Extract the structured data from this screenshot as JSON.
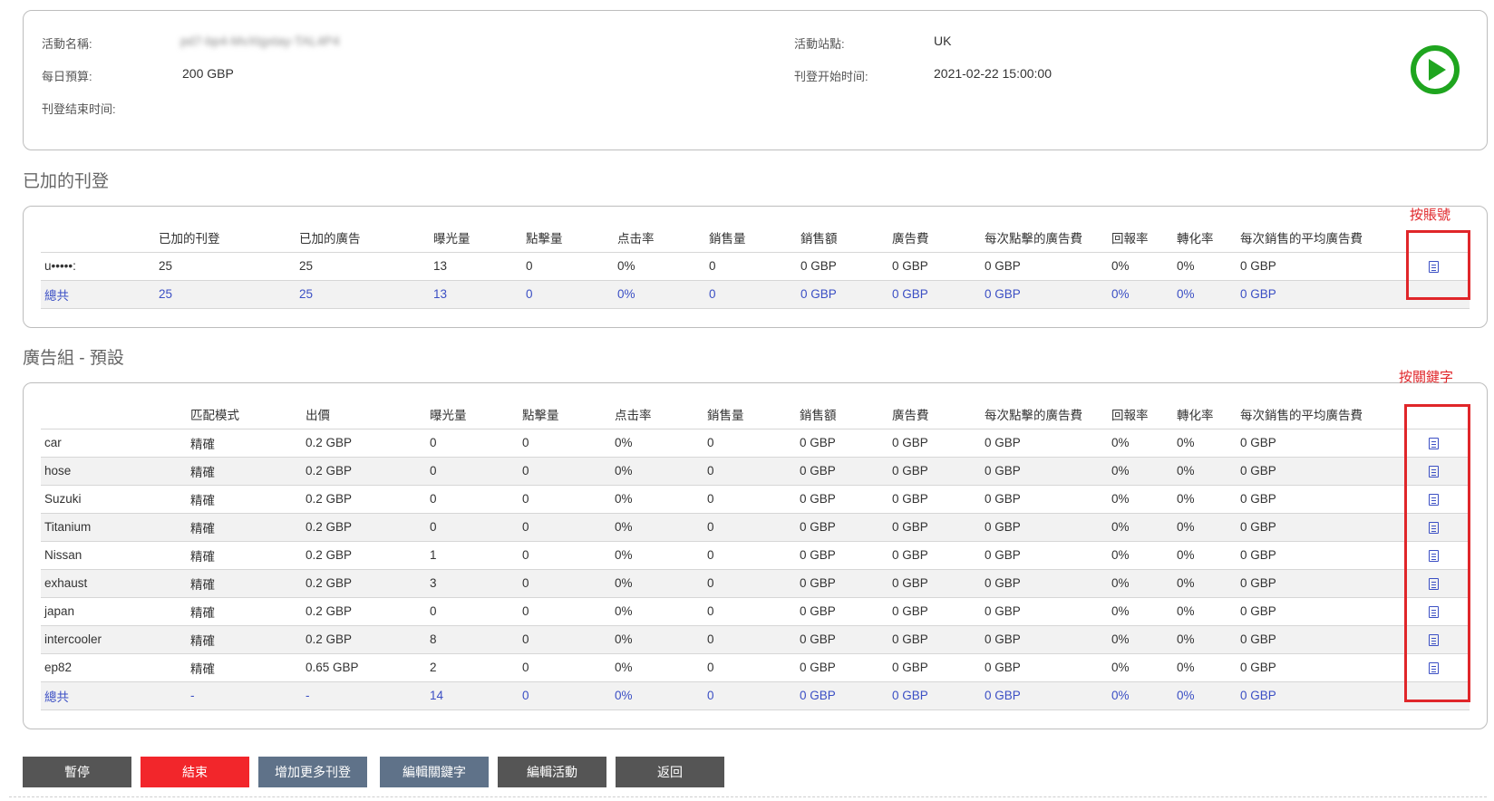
{
  "info": {
    "name_label": "活動名稱:",
    "name_value": "pd7-bp4-MvXtgxtay-TAL4P4",
    "budget_label": "每日預算:",
    "budget_value": "200 GBP",
    "end_label": "刊登结束时间:",
    "end_value": "",
    "site_label": "活動站點:",
    "site_value": "UK",
    "start_label": "刊登开始时间:",
    "start_value": "2021-02-22 15:00:00"
  },
  "listings": {
    "title": "已加的刊登",
    "headers": [
      "",
      "已加的刊登",
      "已加的廣告",
      "曝光量",
      "點擊量",
      "点击率",
      "銷售量",
      "銷售額",
      "廣告費",
      "每次點擊的廣告費",
      "回報率",
      "轉化率",
      "每次銷售的平均廣告費",
      ""
    ],
    "rows": [
      [
        "u•••••:",
        "25",
        "25",
        "13",
        "0",
        "0%",
        "0",
        "0 GBP",
        "0 GBP",
        "0 GBP",
        "0%",
        "0%",
        "0 GBP"
      ]
    ],
    "total": [
      "總共",
      "25",
      "25",
      "13",
      "0",
      "0%",
      "0",
      "0 GBP",
      "0 GBP",
      "0 GBP",
      "0%",
      "0%",
      "0 GBP"
    ],
    "annotation": "按賬號"
  },
  "adgroup": {
    "title": "廣告組 - 預設",
    "headers": [
      "",
      "匹配模式",
      "出價",
      "曝光量",
      "點擊量",
      "点击率",
      "銷售量",
      "銷售額",
      "廣告費",
      "每次點擊的廣告費",
      "回報率",
      "轉化率",
      "每次銷售的平均廣告費",
      ""
    ],
    "rows": [
      [
        "car",
        "精確",
        "0.2 GBP",
        "0",
        "0",
        "0%",
        "0",
        "0 GBP",
        "0 GBP",
        "0 GBP",
        "0%",
        "0%",
        "0 GBP"
      ],
      [
        "hose",
        "精確",
        "0.2 GBP",
        "0",
        "0",
        "0%",
        "0",
        "0 GBP",
        "0 GBP",
        "0 GBP",
        "0%",
        "0%",
        "0 GBP"
      ],
      [
        "Suzuki",
        "精確",
        "0.2 GBP",
        "0",
        "0",
        "0%",
        "0",
        "0 GBP",
        "0 GBP",
        "0 GBP",
        "0%",
        "0%",
        "0 GBP"
      ],
      [
        "Titanium",
        "精確",
        "0.2 GBP",
        "0",
        "0",
        "0%",
        "0",
        "0 GBP",
        "0 GBP",
        "0 GBP",
        "0%",
        "0%",
        "0 GBP"
      ],
      [
        "Nissan",
        "精確",
        "0.2 GBP",
        "1",
        "0",
        "0%",
        "0",
        "0 GBP",
        "0 GBP",
        "0 GBP",
        "0%",
        "0%",
        "0 GBP"
      ],
      [
        "exhaust",
        "精確",
        "0.2 GBP",
        "3",
        "0",
        "0%",
        "0",
        "0 GBP",
        "0 GBP",
        "0 GBP",
        "0%",
        "0%",
        "0 GBP"
      ],
      [
        "japan",
        "精確",
        "0.2 GBP",
        "0",
        "0",
        "0%",
        "0",
        "0 GBP",
        "0 GBP",
        "0 GBP",
        "0%",
        "0%",
        "0 GBP"
      ],
      [
        "intercooler",
        "精確",
        "0.2 GBP",
        "8",
        "0",
        "0%",
        "0",
        "0 GBP",
        "0 GBP",
        "0 GBP",
        "0%",
        "0%",
        "0 GBP"
      ],
      [
        "ep82",
        "精確",
        "0.65 GBP",
        "2",
        "0",
        "0%",
        "0",
        "0 GBP",
        "0 GBP",
        "0 GBP",
        "0%",
        "0%",
        "0 GBP"
      ]
    ],
    "total": [
      "總共",
      "-",
      "-",
      "14",
      "0",
      "0%",
      "0",
      "0 GBP",
      "0 GBP",
      "0 GBP",
      "0%",
      "0%",
      "0 GBP"
    ],
    "annotation": "按關鍵字"
  },
  "buttons": {
    "pause": "暫停",
    "end": "結束",
    "add_listings": "增加更多刊登",
    "edit_keywords": "編輯關鍵字",
    "edit_campaign": "編輯活動",
    "back": "返回"
  },
  "icons": {
    "play": "play-circle-icon",
    "report": "document-icon"
  },
  "colors": {
    "play_green": "#1fa51f",
    "link_blue": "#3b4fc4",
    "highlight_red": "#e0262a",
    "end_button": "#f2262b"
  }
}
